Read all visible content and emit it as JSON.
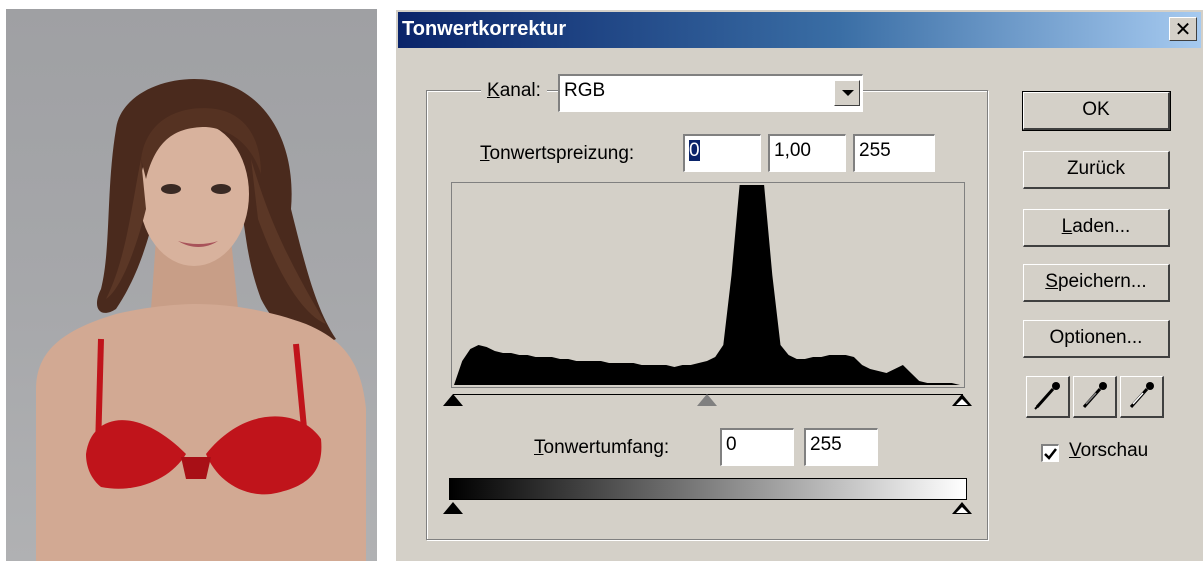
{
  "dialog": {
    "title": "Tonwertkorrektur",
    "close_glyph": "✕"
  },
  "channel": {
    "label_prefix": "K",
    "label_rest": "anal:",
    "value": "RGB"
  },
  "input_levels": {
    "label_prefix": "T",
    "label_rest": "onwertspreizung:",
    "black": "0",
    "gamma": "1,00",
    "white": "255"
  },
  "output_levels": {
    "label_prefix": "T",
    "label_rest": "onwertumfang:",
    "black": "0",
    "white": "255"
  },
  "buttons": {
    "ok": "OK",
    "reset": "Zurück",
    "load_prefix": "L",
    "load_rest": "aden...",
    "save_prefix": "S",
    "save_rest": "peichern...",
    "options": "Optionen..."
  },
  "preview": {
    "label_prefix": "V",
    "label_rest": "orschau",
    "checked": true
  },
  "icons": {
    "black_eyedropper": "eyedropper-black-icon",
    "gray_eyedropper": "eyedropper-gray-icon",
    "white_eyedropper": "eyedropper-white-icon"
  },
  "histogram": {
    "range": [
      0,
      255
    ],
    "relative_levels": [
      0.0,
      0.12,
      0.18,
      0.2,
      0.19,
      0.17,
      0.16,
      0.16,
      0.15,
      0.15,
      0.14,
      0.14,
      0.14,
      0.13,
      0.13,
      0.12,
      0.12,
      0.12,
      0.12,
      0.11,
      0.11,
      0.11,
      0.11,
      0.1,
      0.1,
      0.1,
      0.1,
      0.09,
      0.1,
      0.1,
      0.11,
      0.12,
      0.14,
      0.2,
      0.55,
      1.0,
      1.0,
      1.0,
      1.0,
      0.55,
      0.2,
      0.15,
      0.13,
      0.13,
      0.14,
      0.14,
      0.15,
      0.15,
      0.15,
      0.14,
      0.1,
      0.08,
      0.07,
      0.06,
      0.08,
      0.1,
      0.06,
      0.02,
      0.01,
      0.01,
      0.01,
      0.01,
      0.0
    ]
  },
  "colors": {
    "dialog_bg": "#d4d0c8",
    "title_start": "#0a246a",
    "title_end": "#a6caf0",
    "selection": "#0a246a",
    "bra_red": "#c0141b"
  }
}
